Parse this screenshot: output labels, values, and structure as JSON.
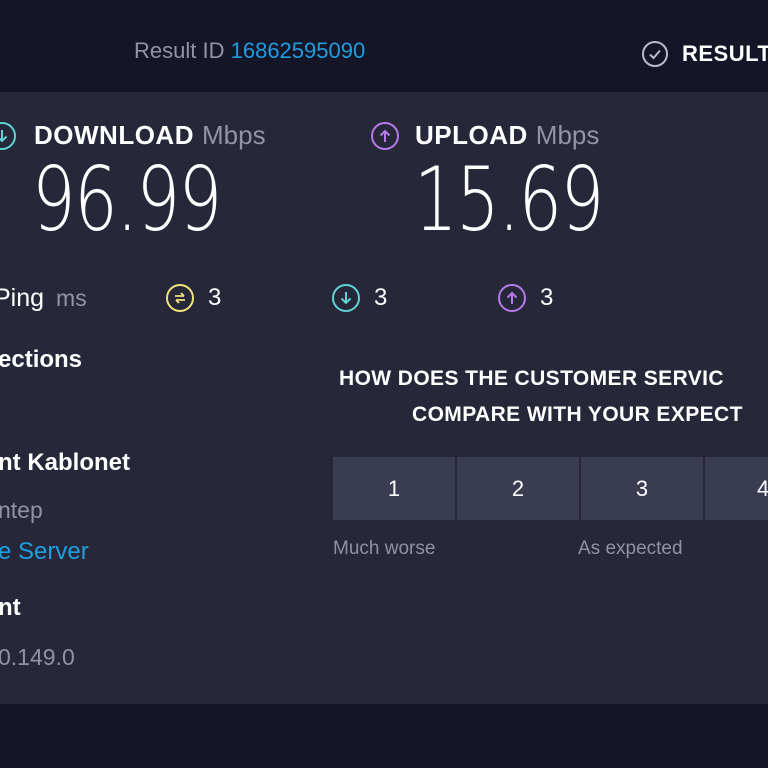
{
  "header": {
    "result_id_label": "Result ID",
    "result_id_value": "16862595090",
    "results_label": "RESULT"
  },
  "download": {
    "label": "DOWNLOAD",
    "unit": "Mbps",
    "value": "96.99",
    "icon": "arrow-down-circle-icon",
    "color": "#5fd3d4"
  },
  "upload": {
    "label": "UPLOAD",
    "unit": "Mbps",
    "value": "15.69",
    "icon": "arrow-up-circle-icon",
    "color": "#b679e8"
  },
  "ping": {
    "label": "Ping",
    "unit": "ms",
    "idle_value": "3",
    "download_value": "3",
    "upload_value": "3",
    "idle_color": "#efe27a"
  },
  "connection": {
    "connections_label": "ections",
    "isp_label": "nt Kablonet",
    "location": "ntep",
    "change_server_link": "e Server",
    "client_label": "nt",
    "ip_address": "0.149.0"
  },
  "survey": {
    "question_line1": "HOW DOES THE CUSTOMER SERVIC",
    "question_line2": "COMPARE WITH YOUR EXPECT",
    "options": [
      "1",
      "2",
      "3",
      "4"
    ],
    "caption_low": "Much worse",
    "caption_mid": "As expected"
  }
}
